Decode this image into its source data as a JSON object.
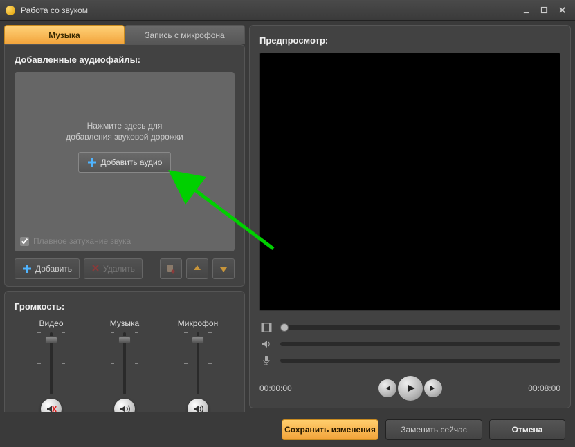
{
  "window": {
    "title": "Работа со звуком"
  },
  "tabs": {
    "music": "Музыка",
    "mic": "Запись с микрофона"
  },
  "audio_panel": {
    "title": "Добавленные аудиофайлы:",
    "hint_line1": "Нажмите здесь для",
    "hint_line2": "добавления звуковой дорожки",
    "add_button": "Добавить аудио",
    "fade_label": "Плавное затухание звука",
    "fade_checked": true
  },
  "toolbar": {
    "add": "Добавить",
    "delete": "Удалить"
  },
  "volume": {
    "title": "Громкость:",
    "video": "Видео",
    "music": "Музыка",
    "mic": "Микрофон"
  },
  "preview": {
    "title": "Предпросмотр:",
    "time_current": "00:00:00",
    "time_total": "00:08:00"
  },
  "footer": {
    "save": "Сохранить изменения",
    "replace": "Заменить сейчас",
    "cancel": "Отмена"
  }
}
